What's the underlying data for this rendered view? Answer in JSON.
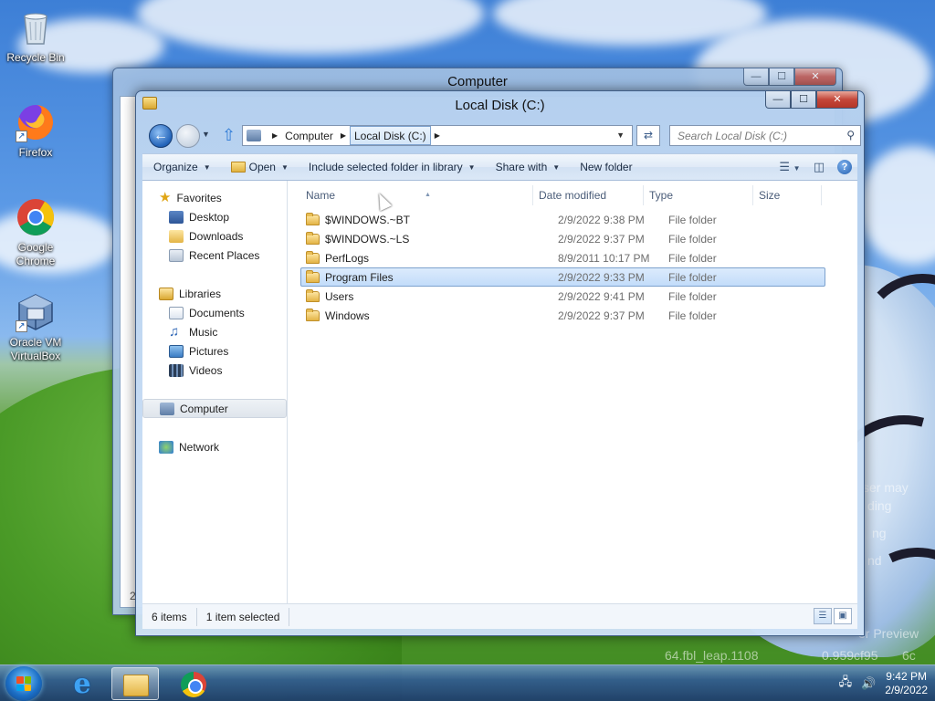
{
  "desktop": {
    "icons": [
      {
        "label_line1": "Recycle Bin",
        "label_line2": ""
      },
      {
        "label_line1": "Firefox",
        "label_line2": ""
      },
      {
        "label_line1": "Google",
        "label_line2": "Chrome"
      },
      {
        "label_line1": "Oracle VM",
        "label_line2": "VirtualBox"
      }
    ],
    "watermark": [
      "ser may",
      "ding",
      "ng",
      "nd",
      "er Preview",
      "64.fbl_leap.1108",
      "0.959cf95",
      "6c"
    ]
  },
  "back_window": {
    "title": "Computer",
    "partial_text": "2"
  },
  "window": {
    "title": "Local Disk (C:)",
    "controls": {
      "minimize": "—",
      "maximize": "☐",
      "close": "✕"
    }
  },
  "navbar": {
    "breadcrumbs": [
      "Computer",
      "Local Disk (C:)"
    ],
    "search_placeholder": "Search Local Disk (C:)"
  },
  "commandbar": {
    "organize": "Organize",
    "open": "Open",
    "include": "Include selected folder in library",
    "share": "Share with",
    "new_folder": "New folder",
    "help": "?"
  },
  "navpane": {
    "favorites": "Favorites",
    "fav_items": [
      "Desktop",
      "Downloads",
      "Recent Places"
    ],
    "libraries": "Libraries",
    "lib_items": [
      "Documents",
      "Music",
      "Pictures",
      "Videos"
    ],
    "computer": "Computer",
    "network": "Network"
  },
  "columns": {
    "name": "Name",
    "date": "Date modified",
    "type": "Type",
    "size": "Size"
  },
  "files": [
    {
      "name": "$WINDOWS.~BT",
      "date": "2/9/2022 9:38 PM",
      "type": "File folder"
    },
    {
      "name": "$WINDOWS.~LS",
      "date": "2/9/2022 9:37 PM",
      "type": "File folder"
    },
    {
      "name": "PerfLogs",
      "date": "8/9/2011 10:17 PM",
      "type": "File folder"
    },
    {
      "name": "Program Files",
      "date": "2/9/2022 9:33 PM",
      "type": "File folder"
    },
    {
      "name": "Users",
      "date": "2/9/2022 9:41 PM",
      "type": "File folder"
    },
    {
      "name": "Windows",
      "date": "2/9/2022 9:37 PM",
      "type": "File folder"
    }
  ],
  "status": {
    "count": "6 items",
    "selected": "1 item selected"
  },
  "taskbar": {
    "time": "9:42 PM",
    "date": "2/9/2022"
  },
  "colors": {
    "accent": "#2263b8",
    "selection": "#c2dcfa",
    "selection_border": "#7da2ce"
  }
}
